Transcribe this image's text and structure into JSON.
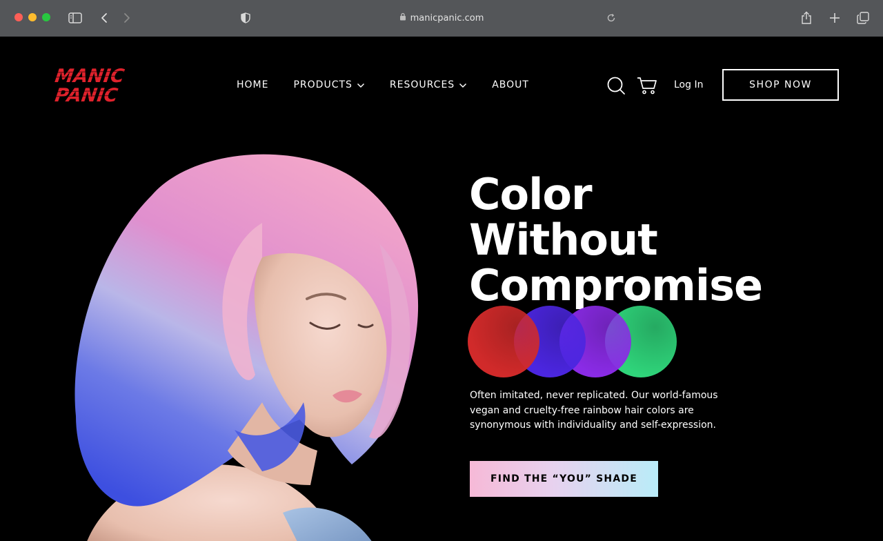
{
  "browser": {
    "url": "manicpanic.com",
    "icons": [
      "sidebar-icon",
      "back-icon",
      "forward-icon",
      "shield-icon",
      "lock-icon",
      "reload-icon",
      "share-icon",
      "new-tab-icon",
      "tabs-icon"
    ]
  },
  "header": {
    "logo_line1": "MANIC",
    "logo_line2": "PANIC",
    "logo_color": "#e0222c",
    "nav": [
      {
        "label": "HOME",
        "dropdown": false
      },
      {
        "label": "PRODUCTS",
        "dropdown": true
      },
      {
        "label": "RESOURCES",
        "dropdown": true
      },
      {
        "label": "ABOUT",
        "dropdown": false
      }
    ],
    "login_label": "Log In",
    "shop_label": "SHOP NOW"
  },
  "hero": {
    "headline": [
      "Color",
      "Without",
      "Compromise"
    ],
    "swatch_colors": [
      "#d12a2a",
      "#4b26e0",
      "#8a2be6",
      "#2fd47a"
    ],
    "description": "Often imitated, never replicated. Our world-famous vegan and cruelty-free rainbow hair colors are synonymous with individuality and self-expression.",
    "cta_label": "FIND THE “YOU” SHADE"
  }
}
